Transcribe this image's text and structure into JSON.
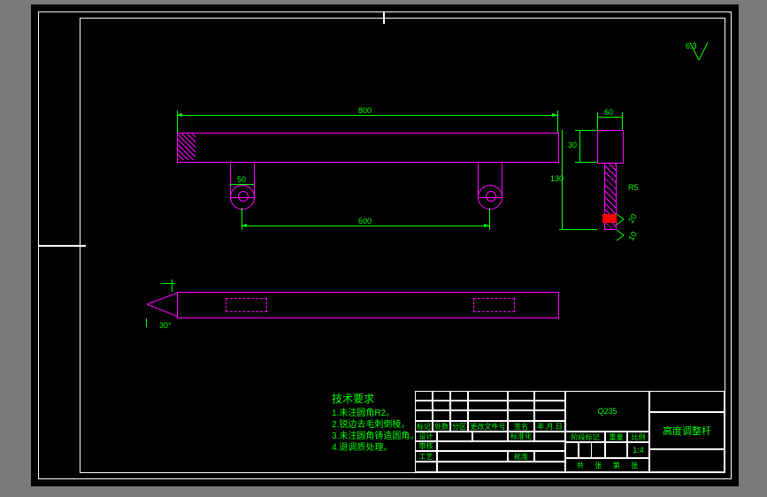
{
  "drawing": {
    "frame_tick_left": "|",
    "frame_tick_top": "—"
  },
  "dimensions": {
    "front_top": "800",
    "front_lug_span": "600",
    "front_lug_w": "50",
    "side_top": "60",
    "side_h1": "30",
    "side_h2": "130",
    "side_r": "R5",
    "side_t1": "20",
    "side_t2": "10",
    "top_angle": "30°"
  },
  "surface_finish": "6.3",
  "tech_requirements": {
    "title": "技术要求",
    "items": [
      "1.未注圆角R2。",
      "2.锐边去毛刺倒棱。",
      "3.未注圆角铸造圆角。",
      "4.退调质处理。"
    ]
  },
  "title_block": {
    "scale_label": "1:4",
    "material": "Q235",
    "part_name": "高度调整杆",
    "cols": {
      "c1": "标记",
      "c2": "处数",
      "c3": "分区",
      "c4": "更改文件号",
      "c5": "签名",
      "c6": "年.月.日"
    },
    "rows": {
      "design": "设计",
      "check": "审核",
      "process": "工艺",
      "approve": "批准",
      "stdchk": "标准化",
      "stage": "阶段标记",
      "weight": "重量",
      "scale": "比例",
      "total": "共",
      "sheet": "张",
      "page": "第",
      "page2": "张"
    }
  }
}
